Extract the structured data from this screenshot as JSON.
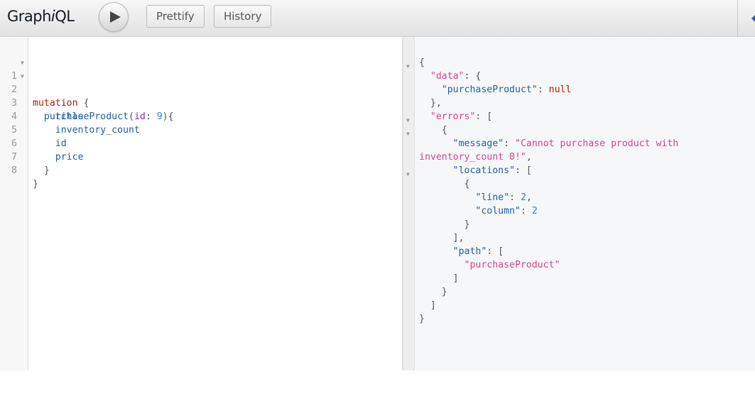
{
  "app": {
    "title_prefix": "Graph",
    "title_italic": "i",
    "title_suffix": "QL"
  },
  "toolbar": {
    "run_label": "Execute query",
    "prettify_label": "Prettify",
    "history_label": "History"
  },
  "query_editor": {
    "line_numbers": [
      "1",
      "2",
      "3",
      "4",
      "5",
      "6",
      "7",
      "8"
    ],
    "lines": {
      "l1": {
        "keyword": "mutation",
        "brace": " {"
      },
      "l2": {
        "indent": "  ",
        "field": "purchaseProduct",
        "open": "(",
        "arg": "id",
        "colon": ": ",
        "value": "9",
        "close": "){"
      },
      "l3": {
        "indent": "    ",
        "field": "title"
      },
      "l4": {
        "indent": "    ",
        "field": "inventory_count"
      },
      "l5": {
        "indent": "    ",
        "field": "id"
      },
      "l6": {
        "indent": "    ",
        "field": "price"
      },
      "l7": {
        "text": "  }"
      },
      "l8": {
        "text": "}"
      }
    }
  },
  "result_viewer": {
    "lines": {
      "r1": "{",
      "r2_key": "\"data\"",
      "r2_rest": ": {",
      "r3_key": "\"purchaseProduct\"",
      "r3_colon": ": ",
      "r3_val": "null",
      "r4": "},",
      "r5_key": "\"errors\"",
      "r5_rest": ": [",
      "r6": "{",
      "r7_key": "\"message\"",
      "r7_colon": ": ",
      "r7_val": "\"Cannot purchase product with",
      "r8_val": "inventory_count 0!\"",
      "r8_rest": ",",
      "r9_key": "\"locations\"",
      "r9_rest": ": [",
      "r10": "{",
      "r11_key": "\"line\"",
      "r11_colon": ": ",
      "r11_val": "2",
      "r11_rest": ",",
      "r12_key": "\"column\"",
      "r12_colon": ": ",
      "r12_val": "2",
      "r13": "}",
      "r14": "],",
      "r15_key": "\"path\"",
      "r15_rest": ": [",
      "r16_val": "\"purchaseProduct\"",
      "r17": "]",
      "r18": "}",
      "r19": "]",
      "r20": "}"
    }
  }
}
